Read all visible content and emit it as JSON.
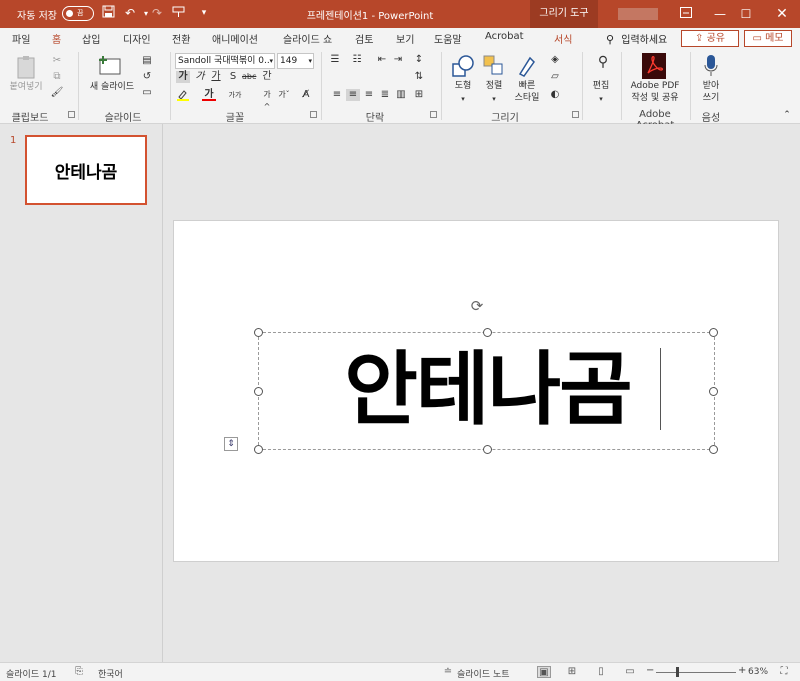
{
  "titlebar": {
    "autosave_label": "자동 저장",
    "autosave_state": "끔",
    "document_title": "프레젠테이션1  -  PowerPoint",
    "context_tab": "그리기 도구",
    "icons": [
      "save-icon",
      "undo-icon",
      "redo-icon",
      "customize-icon",
      "dropdown-icon"
    ],
    "window_controls": [
      "ribbon-display-icon",
      "minimize-icon",
      "maximize-icon",
      "close-icon"
    ]
  },
  "tabs": [
    "파일",
    "홈",
    "삽입",
    "디자인",
    "전환",
    "애니메이션",
    "슬라이드 쇼",
    "검토",
    "보기",
    "도움말",
    "Acrobat",
    "서식"
  ],
  "active_tab": "홈",
  "search_label": "입력하세요",
  "share_label": "공유",
  "memo_label": "메모",
  "ribbon": {
    "clipboard": {
      "paste_label": "붙여넣기",
      "group": "클립보드"
    },
    "slides": {
      "new_slide_label": "새 슬라이드",
      "group": "슬라이드"
    },
    "font": {
      "font_name": "Sandoll 국대떡볶이 0..",
      "font_size": "149",
      "bold": "가",
      "italic": "가",
      "underline": "가",
      "shadow": "S",
      "strike": "abc",
      "spacing": "간",
      "grow": "가^",
      "shrink": "가ˇ",
      "clear": "A",
      "change_case": "가가",
      "font_color": "가",
      "group": "글꼴"
    },
    "paragraph": {
      "group": "단락"
    },
    "drawing": {
      "shapes_label": "도형",
      "arrange_label": "정렬",
      "styles_label_1": "빠른",
      "styles_label_2": "스타일",
      "group": "그리기"
    },
    "editing": {
      "label": "편집"
    },
    "acrobat": {
      "label_1": "Adobe PDF",
      "label_2": "작성 및 공유",
      "group": "Adobe Acrobat"
    },
    "voice": {
      "label_1": "받아",
      "label_2": "쓰기",
      "group": "음성"
    }
  },
  "thumbnail": {
    "number": "1",
    "text": "안테나곰"
  },
  "slide": {
    "text": "안테나곰"
  },
  "status": {
    "slide_info": "슬라이드 1/1",
    "language": "한국어",
    "notes_label": "슬라이드 노트",
    "zoom": "63%",
    "zoom_minus": "−",
    "zoom_plus": "+"
  }
}
